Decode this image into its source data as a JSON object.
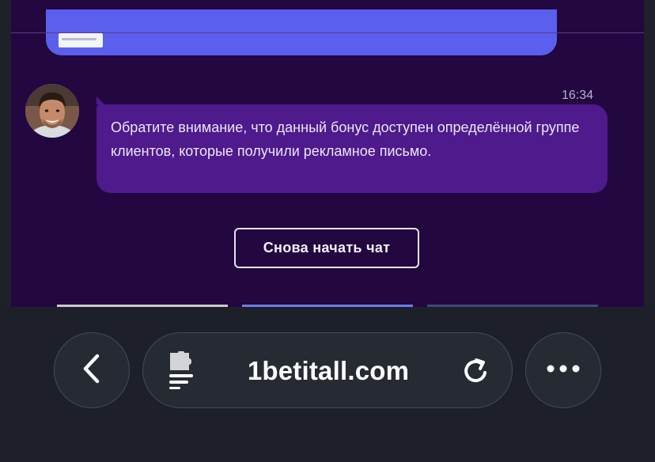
{
  "chat": {
    "message": {
      "time": "16:34",
      "text": "Обратите внимание, что данный бонус доступен определённой группе клиентов, которые получили рекламное письмо."
    },
    "restart_button_label": "Снова начать чат",
    "avatar": "agent-avatar"
  },
  "browser": {
    "url": "1betitall.com",
    "icons": {
      "back": "chevron-left-icon",
      "extension": "puzzle-page-icon",
      "reload": "reload-icon",
      "more": "ellipsis-icon"
    }
  },
  "colors": {
    "chat_background": "#220741",
    "message_bubble": "#4e1a8c",
    "previous_bubble": "#5b5fee",
    "toolbar_background": "#1d2028"
  }
}
